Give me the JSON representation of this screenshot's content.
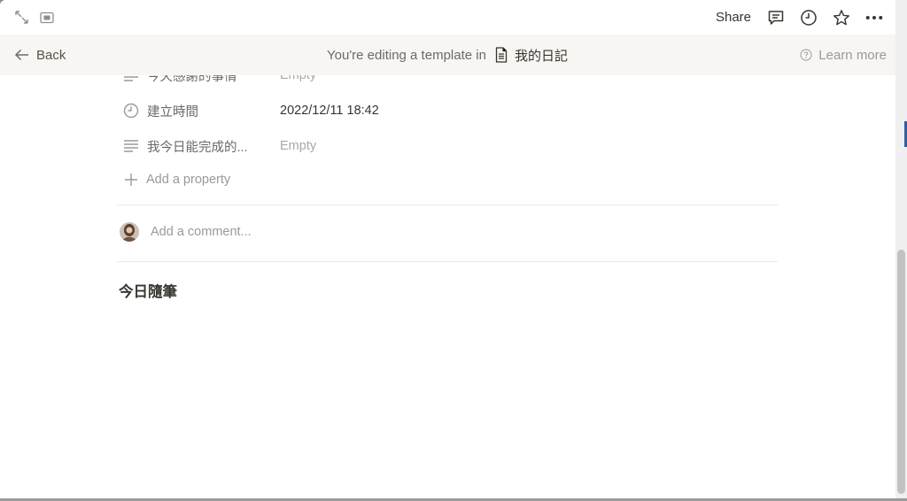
{
  "topbar": {
    "share_label": "Share",
    "icons": [
      "expand-icon",
      "peek-mode-icon",
      "comment-icon",
      "clock-icon",
      "star-icon",
      "more-icon"
    ]
  },
  "banner": {
    "back_label": "Back",
    "editing_text": "You're editing a template in",
    "database_name": "我的日記",
    "learn_more_label": "Learn more"
  },
  "properties": [
    {
      "name": "今天感謝的事情",
      "value": "Empty",
      "icon": "text-lines-icon",
      "empty": true
    },
    {
      "name": "建立時間",
      "value": "2022/12/11 18:42",
      "icon": "clock-icon",
      "empty": false
    },
    {
      "name": "我今日能完成的...",
      "value": "Empty",
      "icon": "text-lines-icon",
      "empty": true
    }
  ],
  "add_property_label": "Add a property",
  "comment_placeholder": "Add a comment...",
  "page_heading": "今日隨筆",
  "colors": {
    "banner_bg": "#f7f6f3",
    "text": "#37352f",
    "muted": "#9b9a97",
    "accent_marker": "#2f5ea8"
  }
}
